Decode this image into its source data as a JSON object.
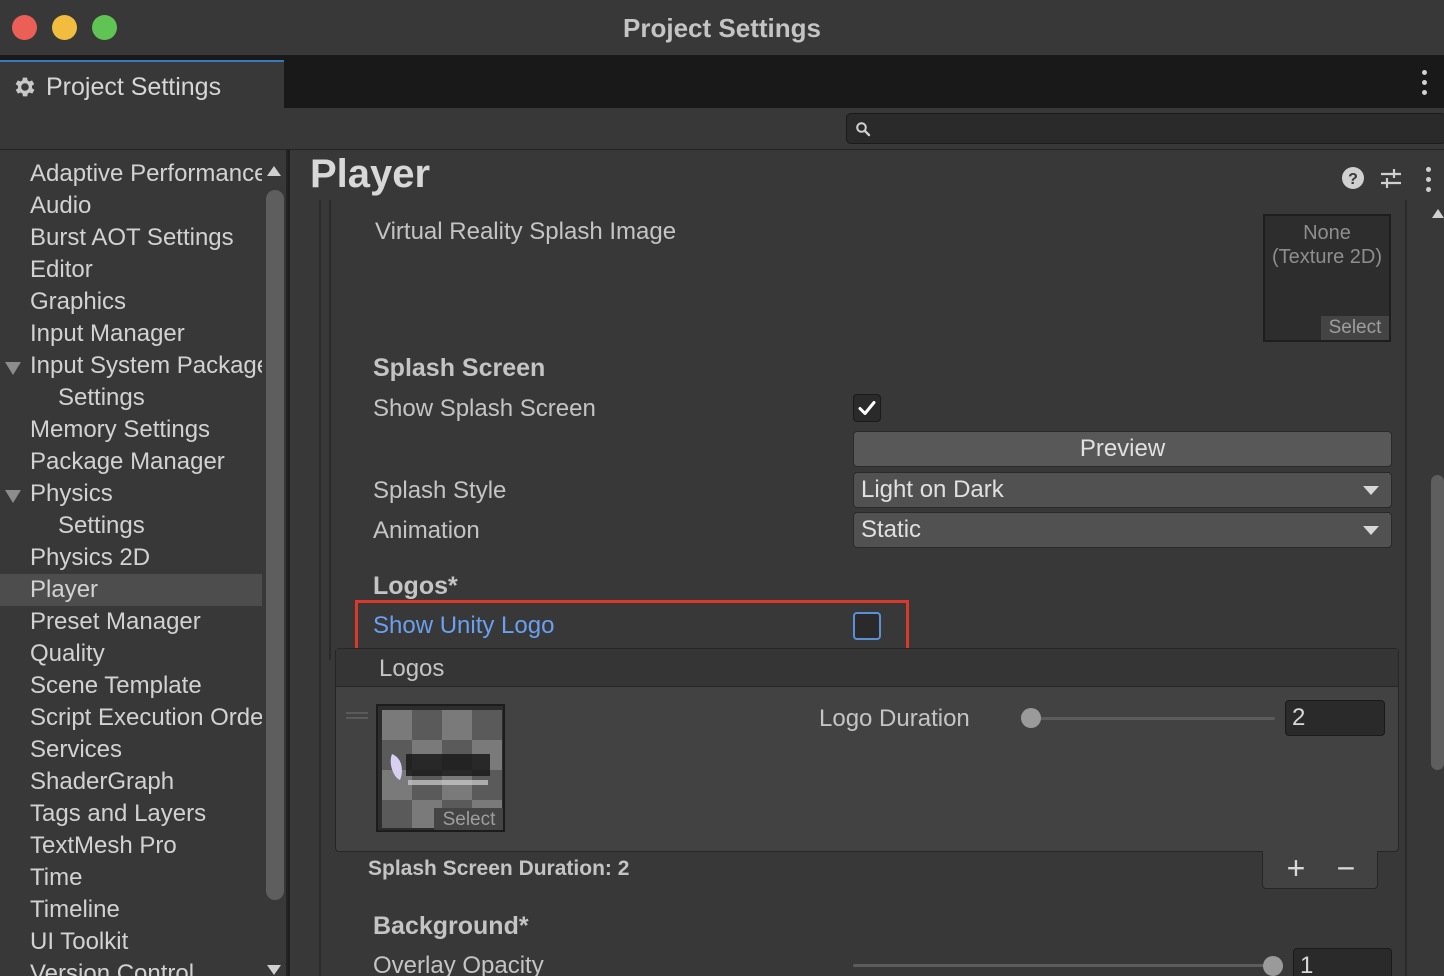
{
  "window": {
    "title": "Project Settings"
  },
  "tab": {
    "label": "Project Settings"
  },
  "search": {
    "placeholder": ""
  },
  "sidebar": {
    "items": [
      {
        "label": "Adaptive Performance"
      },
      {
        "label": "Audio"
      },
      {
        "label": "Burst AOT Settings"
      },
      {
        "label": "Editor"
      },
      {
        "label": "Graphics"
      },
      {
        "label": "Input Manager"
      },
      {
        "label": "Input System Package"
      },
      {
        "label": "Settings"
      },
      {
        "label": "Memory Settings"
      },
      {
        "label": "Package Manager"
      },
      {
        "label": "Physics"
      },
      {
        "label": "Settings"
      },
      {
        "label": "Physics 2D"
      },
      {
        "label": "Player"
      },
      {
        "label": "Preset Manager"
      },
      {
        "label": "Quality"
      },
      {
        "label": "Scene Template"
      },
      {
        "label": "Script Execution Order"
      },
      {
        "label": "Services"
      },
      {
        "label": "ShaderGraph"
      },
      {
        "label": "Tags and Layers"
      },
      {
        "label": "TextMesh Pro"
      },
      {
        "label": "Time"
      },
      {
        "label": "Timeline"
      },
      {
        "label": "UI Toolkit"
      },
      {
        "label": "Version Control"
      }
    ]
  },
  "main": {
    "title": "Player",
    "vr_splash_label": "Virtual Reality Splash Image",
    "texture_none": "None",
    "texture_type": "(Texture 2D)",
    "texture_select": "Select",
    "splash_header": "Splash Screen",
    "show_splash_label": "Show Splash Screen",
    "show_splash_checked": true,
    "preview_label": "Preview",
    "splash_style_label": "Splash Style",
    "splash_style_value": "Light on Dark",
    "animation_label": "Animation",
    "animation_value": "Static",
    "logos_header": "Logos*",
    "show_unity_logo_label": "Show Unity Logo",
    "show_unity_logo_checked": false,
    "logos_list_header": "Logos",
    "logo_select": "Select",
    "logo_duration_label": "Logo Duration",
    "logo_duration_value": "2",
    "logo_duration_slider_fraction": 0.0,
    "splash_duration_label": "Splash Screen Duration: 2",
    "add_symbol": "+",
    "remove_symbol": "−",
    "background_header": "Background*",
    "overlay_opacity_label": "Overlay Opacity",
    "overlay_opacity_value": "1",
    "overlay_opacity_slider_fraction": 1.0
  },
  "icons": {
    "gear": "gear-icon",
    "search": "search-icon",
    "help": "help-icon",
    "presets": "sliders-icon",
    "more": "more-icon"
  },
  "colors": {
    "highlight_box": "#d9382b",
    "link_blue": "#6aa0ee",
    "tab_accent": "#3a79bb"
  }
}
